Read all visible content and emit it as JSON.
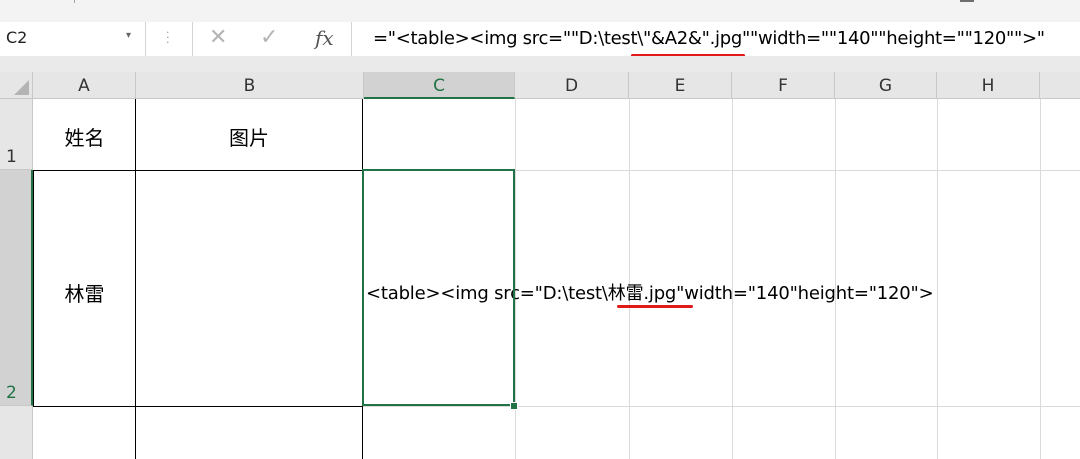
{
  "formula_bar": {
    "name_box": "C2",
    "dropdown_glyph": "▾",
    "cancel_glyph": "✕",
    "enter_glyph": "✓",
    "fx_glyph": "fx",
    "formula_pre": "=\"<table><img src=\"\"D:\\test\\",
    "formula_mid": "\"&A2&\".jpg\"",
    "formula_post": "\"width=\"\"140\"\"height=\"\"120\"\">\""
  },
  "columns": [
    "A",
    "B",
    "C",
    "D",
    "E",
    "F",
    "G",
    "H"
  ],
  "rows": [
    "1",
    "2"
  ],
  "cells": {
    "A1": "姓名",
    "B1": "图片",
    "A2": "林雷",
    "C2_pre": "<table><img src=\"D:\\test\\",
    "C2_mid": "林雷.jpg",
    "C2_post": "\"width=\"140\"height=\"120\">"
  },
  "colors": {
    "accent": "#217346",
    "annotation": "#e01919"
  },
  "icons": [
    "dropdown-arrow-icon",
    "cancel-icon",
    "enter-check-icon",
    "function-icon"
  ]
}
